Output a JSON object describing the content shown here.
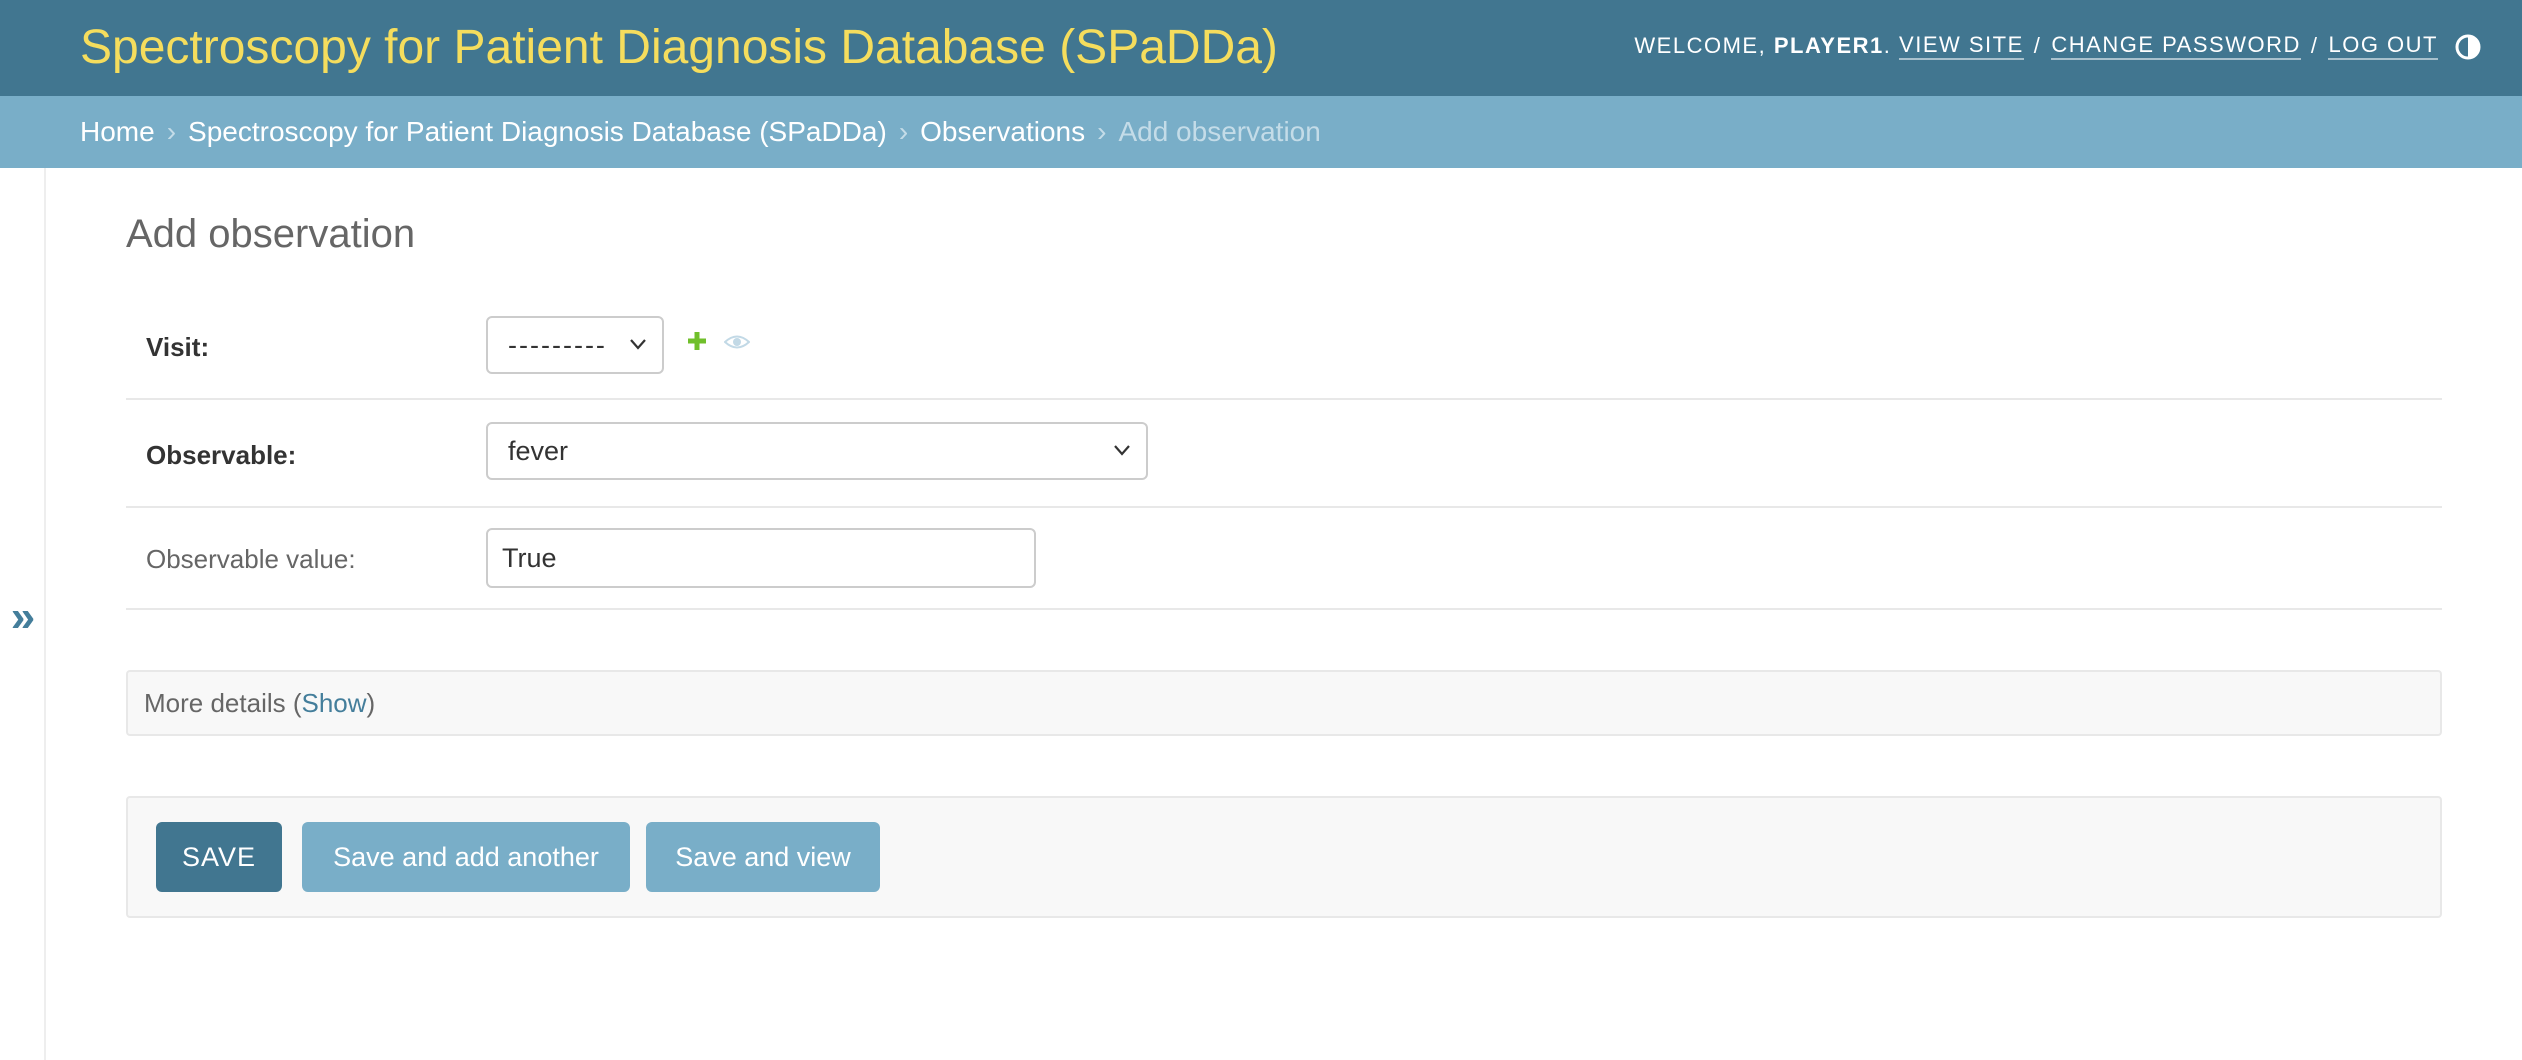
{
  "header": {
    "site_title": "Spectroscopy for Patient Diagnosis Database (SPaDDa)",
    "welcome_label": "WELCOME,",
    "username": "PLAYER1",
    "view_site": "VIEW SITE",
    "change_password": "CHANGE PASSWORD",
    "log_out": "LOG OUT",
    "separator": "/",
    "period": "."
  },
  "breadcrumbs": {
    "items": [
      "Home",
      "Spectroscopy for Patient Diagnosis Database (SPaDDa)",
      "Observations"
    ],
    "current": "Add observation",
    "separator": "›"
  },
  "sidebar": {
    "toggle_glyph": "»"
  },
  "page": {
    "title": "Add observation"
  },
  "form": {
    "visit": {
      "label": "Visit:",
      "value": "---------"
    },
    "observable": {
      "label": "Observable:",
      "value": "fever"
    },
    "observable_value": {
      "label": "Observable value:",
      "value": "True"
    }
  },
  "more_details": {
    "prefix": "More details (",
    "link": "Show",
    "suffix": ")"
  },
  "submit": {
    "save": "SAVE",
    "save_add_another": "Save and add another",
    "save_view": "Save and view"
  },
  "colors": {
    "header_bg": "#417690",
    "site_title": "#f5dd5d",
    "breadcrumb_bg": "#79aec8",
    "primary_button": "#417690",
    "secondary_button": "#79aec8",
    "add_icon": "#70bf2b",
    "link": "#447e9b"
  },
  "icons": {
    "theme": "half-circle-icon",
    "add": "plus-icon",
    "view": "eye-icon",
    "dropdown": "chevron-down-icon",
    "sidebar_toggle": "double-chevron-right-icon"
  }
}
